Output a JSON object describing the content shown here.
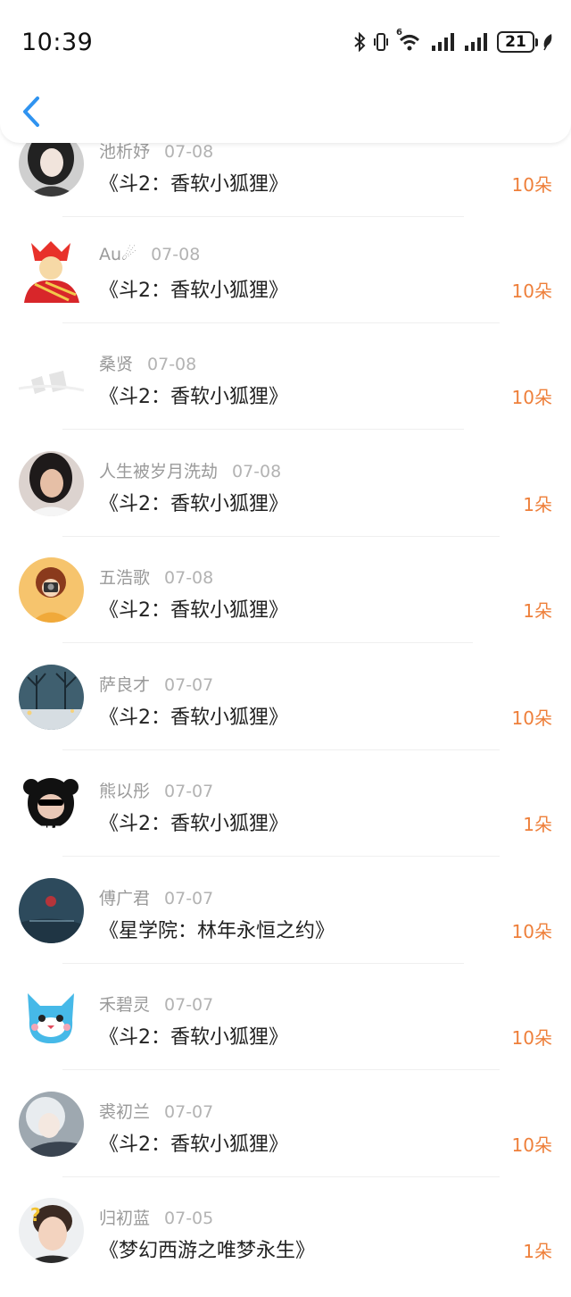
{
  "status_bar": {
    "time": "10:39",
    "network_label": "6",
    "battery": "21"
  },
  "nav": {
    "back_icon": "chevron-left-icon",
    "accent": "#2f93f0"
  },
  "colors": {
    "amount": "#ee7f3a",
    "name": "#9a9a9a",
    "title": "#222222"
  },
  "records": [
    {
      "name": "池析妤",
      "date": "07-08",
      "title": "《斗2：香软小狐狸》",
      "amount": "10朵",
      "avatar": "girl-dark-hair"
    },
    {
      "name": "Au☄",
      "date": "07-08",
      "title": "《斗2：香软小狐狸》",
      "amount": "10朵",
      "avatar": "cartoon-red-king"
    },
    {
      "name": "桑贤",
      "date": "07-08",
      "title": "《斗2：香软小狐狸》",
      "amount": "10朵",
      "avatar": "light-sketch"
    },
    {
      "name": "人生被岁月洗劫",
      "date": "07-08",
      "title": "《斗2：香软小狐狸》",
      "amount": "1朵",
      "avatar": "girl-portrait"
    },
    {
      "name": "五浩歌",
      "date": "07-08",
      "title": "《斗2：香软小狐狸》",
      "amount": "1朵",
      "avatar": "cartoon-girl-camera"
    },
    {
      "name": "萨良才",
      "date": "07-07",
      "title": "《斗2：香软小狐狸》",
      "amount": "10朵",
      "avatar": "winter-street"
    },
    {
      "name": "熊以彤",
      "date": "07-07",
      "title": "《斗2：香软小狐狸》",
      "amount": "1朵",
      "avatar": "bear-sunglasses"
    },
    {
      "name": "傅广君",
      "date": "07-07",
      "title": "《星学院：林年永恒之约》",
      "amount": "10朵",
      "avatar": "blue-moody"
    },
    {
      "name": "禾碧灵",
      "date": "07-07",
      "title": "《斗2：香软小狐狸》",
      "amount": "10朵",
      "avatar": "blue-cat"
    },
    {
      "name": "裘初兰",
      "date": "07-07",
      "title": "《斗2：香软小狐狸》",
      "amount": "10朵",
      "avatar": "anime-boy"
    },
    {
      "name": "归初蓝",
      "date": "07-05",
      "title": "《梦幻西游之唯梦永生》",
      "amount": "1朵",
      "avatar": "boy-question"
    }
  ]
}
